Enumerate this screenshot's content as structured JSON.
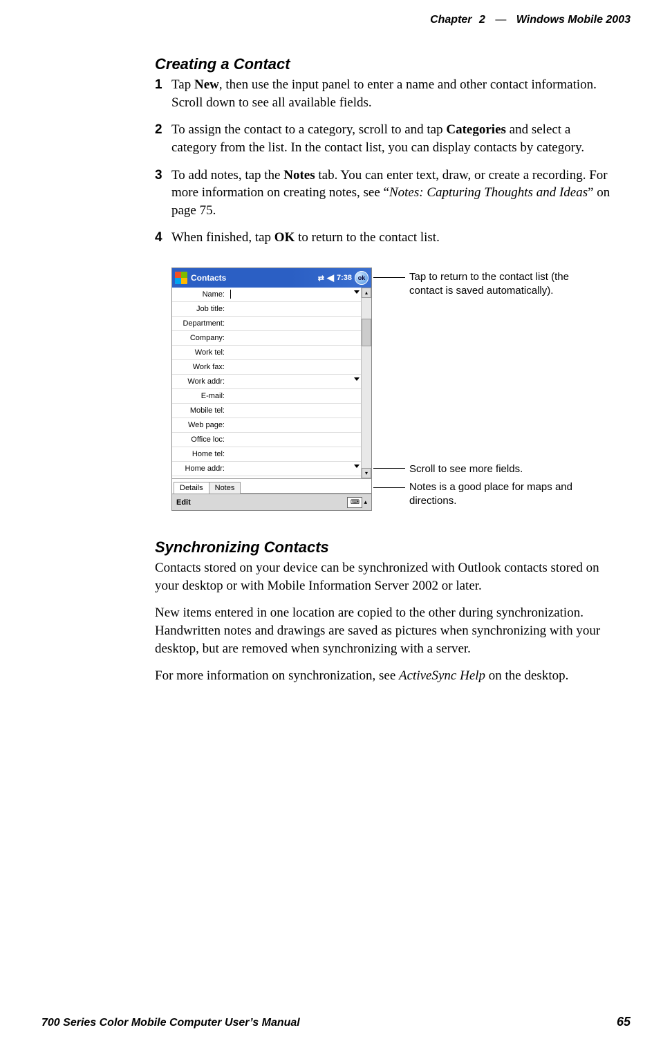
{
  "header": {
    "chapter": "Chapter",
    "chapterNum": "2",
    "dash": "—",
    "title": "Windows Mobile 2003"
  },
  "section1": {
    "heading": "Creating a Contact",
    "steps": [
      {
        "num": "1",
        "pre": "Tap ",
        "bold": "New",
        "post": ", then use the input panel to enter a name and other contact information. Scroll down to see all available fields."
      },
      {
        "num": "2",
        "pre": "To assign the contact to a category, scroll to and tap ",
        "bold": "Categories",
        "post": " and select a category from the list. In the contact list, you can display contacts by category."
      },
      {
        "num": "3",
        "pre": "To add notes, tap the ",
        "bold": "Notes",
        "post_a": " tab. You can enter text, draw, or create a recording. For more information on creating notes, see “",
        "italic": "Notes: Capturing Thoughts and Ideas",
        "post_b": "” on page 75."
      },
      {
        "num": "4",
        "pre": "When finished, tap ",
        "bold": "OK",
        "post": " to return to the contact list."
      }
    ]
  },
  "pda": {
    "title": "Contacts",
    "time": "7:38",
    "ok": "ok",
    "fields": [
      "Name:",
      "Job title:",
      "Department:",
      "Company:",
      "Work tel:",
      "Work fax:",
      "Work addr:",
      "E-mail:",
      "Mobile tel:",
      "Web page:",
      "Office loc:",
      "Home tel:",
      "Home addr:"
    ],
    "tabs": {
      "details": "Details",
      "notes": "Notes"
    },
    "edit": "Edit"
  },
  "callouts": {
    "c1": "Tap to return to the contact list (the contact is saved automatically).",
    "c2": "Scroll to see more fields.",
    "c3": "Notes is a good place for maps and directions."
  },
  "section2": {
    "heading": "Synchronizing Contacts",
    "p1": "Contacts stored on your device can be synchronized with Outlook contacts stored on your desktop or with Mobile Information Server 2002 or later.",
    "p2": "New items entered in one location are copied to the other during synchronization. Handwritten notes and drawings are saved as pictures when synchronizing with your desktop, but are removed when synchronizing with a server.",
    "p3a": "For more information on synchronization, see ",
    "p3i": "ActiveSync Help",
    "p3b": " on the desktop."
  },
  "footer": {
    "left": "700 Series Color Mobile Computer User’s Manual",
    "right": "65"
  }
}
